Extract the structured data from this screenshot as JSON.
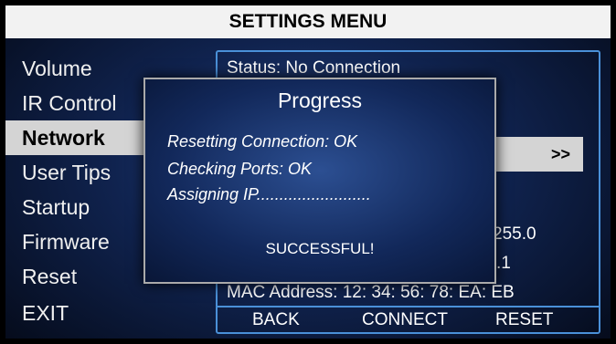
{
  "header": {
    "title": "SETTINGS MENU"
  },
  "menu": {
    "items": [
      "Volume",
      "IR Control",
      "Network",
      "User Tips",
      "Startup",
      "Firmware",
      "Reset",
      "EXIT"
    ],
    "selected_index": 2
  },
  "network_panel": {
    "status": "Status: No Connection",
    "arrow": ">>",
    "subnet_fragment": "255.0",
    "gateway_fragment": ".1",
    "mac_address": "MAC Address: 12: 34: 56: 78: EA: EB"
  },
  "footer": {
    "back": "BACK",
    "connect": "CONNECT",
    "reset": "RESET"
  },
  "dialog": {
    "title": "Progress",
    "lines": [
      "Resetting Connection:  OK",
      "Checking Ports:  OK",
      "Assigning IP........................."
    ],
    "result": "SUCCESSFUL!"
  },
  "colors": {
    "accent_border": "#4a90d8",
    "highlight": "#d4d4d4",
    "background": "#10234f"
  }
}
